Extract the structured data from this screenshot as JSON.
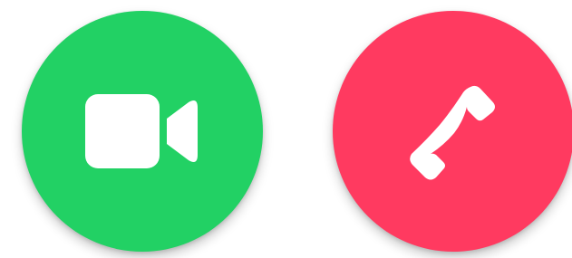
{
  "buttons": {
    "video": {
      "icon": "video-camera-icon",
      "color": "#22d164"
    },
    "decline": {
      "icon": "phone-handset-icon",
      "color": "#ff3a60"
    }
  },
  "icon_color": "#ffffff"
}
